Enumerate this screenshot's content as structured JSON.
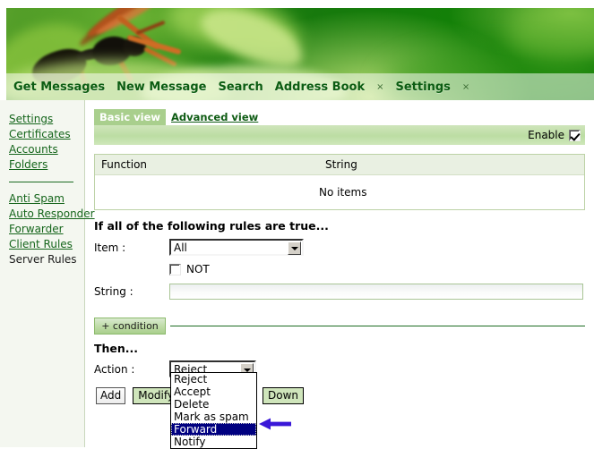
{
  "app": {
    "banner_alt": "wasp-on-leaf-banner"
  },
  "nav": {
    "items": [
      {
        "label": "Get Messages",
        "closable": false
      },
      {
        "label": "New Message",
        "closable": false
      },
      {
        "label": "Search",
        "closable": false
      },
      {
        "label": "Address Book",
        "closable": true
      },
      {
        "label": "Settings",
        "closable": true
      }
    ],
    "close_glyph": "×"
  },
  "sidebar": {
    "group1": [
      {
        "label": "Settings",
        "link": true
      },
      {
        "label": "Certificates",
        "link": true
      },
      {
        "label": "Accounts",
        "link": true
      },
      {
        "label": "Folders",
        "link": true
      }
    ],
    "group2": [
      {
        "label": "Anti Spam",
        "link": true
      },
      {
        "label": "Auto Responder",
        "link": true
      },
      {
        "label": "Forwarder",
        "link": true
      },
      {
        "label": "Client Rules",
        "link": true
      },
      {
        "label": "Server Rules",
        "link": false
      }
    ]
  },
  "tabs": {
    "active": "Basic view",
    "inactive": "Advanced view"
  },
  "enable": {
    "label": "Enable",
    "checked": true
  },
  "table": {
    "columns": [
      "Function",
      "String"
    ],
    "empty_message": "No items",
    "rows": []
  },
  "conditions": {
    "heading": "If all of the following rules are true...",
    "item_label": "Item :",
    "item_value": "All",
    "not_label": "NOT",
    "not_checked": false,
    "string_label": "String :",
    "string_value": "",
    "add_condition_label": "+ condition"
  },
  "then": {
    "heading": "Then...",
    "action_label": "Action :",
    "action_value": "Reject",
    "action_options": [
      "Reject",
      "Accept",
      "Delete",
      "Mark as spam",
      "Forward",
      "Notify"
    ],
    "highlighted_option": "Forward"
  },
  "buttons": {
    "add": "Add",
    "modify": "Modify",
    "down": "Down"
  },
  "colors": {
    "brand_green": "#0b5c12",
    "accent_light_green": "#a9cf8d",
    "bar_green": "#bcdda3",
    "link_green": "#15651b",
    "select_highlight": "#000080",
    "annotation_arrow": "#3a18d8"
  }
}
